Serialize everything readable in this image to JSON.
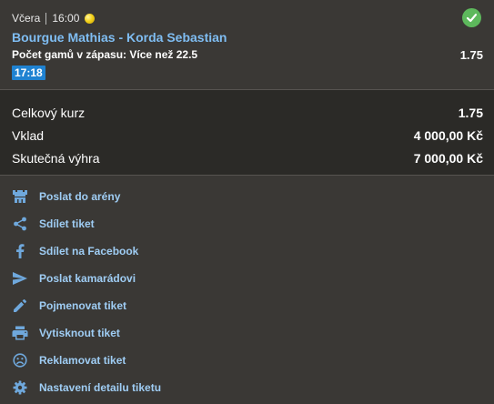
{
  "bet": {
    "day": "Včera",
    "time": "16:00",
    "status": "won",
    "match_title": "Bourgue Mathias - Korda Sebastian",
    "market": "Počet gamů v zápasu: Více než 22.5",
    "odds": "1.75",
    "score_badge": "17:18"
  },
  "summary": {
    "total_odds_label": "Celkový kurz",
    "total_odds_value": "1.75",
    "stake_label": "Vklad",
    "stake_value": "4 000,00 Kč",
    "payout_label": "Skutečná výhra",
    "payout_value": "7 000,00 Kč"
  },
  "actions": [
    {
      "label": "Poslat do arény",
      "icon": "arena-icon"
    },
    {
      "label": "Sdílet tiket",
      "icon": "share-icon"
    },
    {
      "label": "Sdílet na Facebook",
      "icon": "facebook-icon"
    },
    {
      "label": "Poslat kamarádovi",
      "icon": "send-icon"
    },
    {
      "label": "Pojmenovat tiket",
      "icon": "pencil-icon"
    },
    {
      "label": "Vytisknout tiket",
      "icon": "printer-icon"
    },
    {
      "label": "Reklamovat tiket",
      "icon": "sad-face-icon"
    },
    {
      "label": "Nastavení detailu tiketu",
      "icon": "gear-icon"
    }
  ],
  "colors": {
    "accent": "#7fbdf2",
    "success": "#5db85c",
    "badge": "#1f82d1",
    "panel": "#3a3835",
    "panel_dark": "#2b2a27"
  }
}
